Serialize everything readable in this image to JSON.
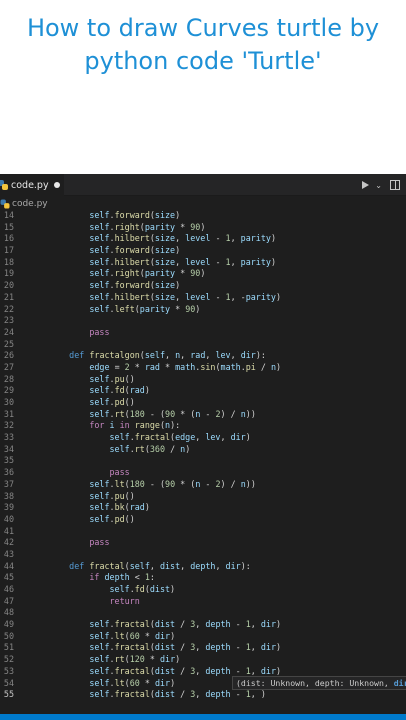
{
  "video_title": "How to draw Curves turtle by python code 'Turtle'",
  "tab": {
    "label": "code.py",
    "icon": "python-file-icon",
    "modified": true
  },
  "breadcrumb": {
    "label": "code.py"
  },
  "toolbar": {
    "run_icon": "run-icon",
    "split_icon": "split-editor-icon"
  },
  "colors": {
    "accent": "#1e90d6",
    "editor_bg": "#1e1e1e",
    "status_bar": "#007acc"
  },
  "code_lines": [
    {
      "number": "14",
      "text": "        self.forward(size)"
    },
    {
      "number": "15",
      "text": "        self.right(parity * 90)"
    },
    {
      "number": "16",
      "text": "        self.hilbert(size, level - 1, parity)"
    },
    {
      "number": "17",
      "text": "        self.forward(size)"
    },
    {
      "number": "18",
      "text": "        self.hilbert(size, level - 1, parity)"
    },
    {
      "number": "19",
      "text": "        self.right(parity * 90)"
    },
    {
      "number": "20",
      "text": "        self.forward(size)"
    },
    {
      "number": "21",
      "text": "        self.hilbert(size, level - 1, -parity)"
    },
    {
      "number": "22",
      "text": "        self.left(parity * 90)"
    },
    {
      "number": "23",
      "text": ""
    },
    {
      "number": "24",
      "text": "        pass"
    },
    {
      "number": "25",
      "text": ""
    },
    {
      "number": "26",
      "text": "    def fractalgon(self, n, rad, lev, dir):"
    },
    {
      "number": "27",
      "text": "        edge = 2 * rad * math.sin(math.pi / n)"
    },
    {
      "number": "28",
      "text": "        self.pu()"
    },
    {
      "number": "29",
      "text": "        self.fd(rad)"
    },
    {
      "number": "30",
      "text": "        self.pd()"
    },
    {
      "number": "31",
      "text": "        self.rt(180 - (90 * (n - 2) / n))"
    },
    {
      "number": "32",
      "text": "        for i in range(n):"
    },
    {
      "number": "33",
      "text": "            self.fractal(edge, lev, dir)"
    },
    {
      "number": "34",
      "text": "            self.rt(360 / n)"
    },
    {
      "number": "35",
      "text": ""
    },
    {
      "number": "36",
      "text": "            pass"
    },
    {
      "number": "37",
      "text": "        self.lt(180 - (90 * (n - 2) / n))"
    },
    {
      "number": "38",
      "text": "        self.pu()"
    },
    {
      "number": "39",
      "text": "        self.bk(rad)"
    },
    {
      "number": "40",
      "text": "        self.pd()"
    },
    {
      "number": "41",
      "text": ""
    },
    {
      "number": "42",
      "text": "        pass"
    },
    {
      "number": "43",
      "text": ""
    },
    {
      "number": "44",
      "text": "    def fractal(self, dist, depth, dir):"
    },
    {
      "number": "45",
      "text": "        if depth < 1:"
    },
    {
      "number": "46",
      "text": "            self.fd(dist)"
    },
    {
      "number": "47",
      "text": "            return"
    },
    {
      "number": "48",
      "text": ""
    },
    {
      "number": "49",
      "text": "        self.fractal(dist / 3, depth - 1, dir)"
    },
    {
      "number": "50",
      "text": "        self.lt(60 * dir)"
    },
    {
      "number": "51",
      "text": "        self.fractal(dist / 3, depth - 1, dir)"
    },
    {
      "number": "52",
      "text": "        self.rt(120 * dir)"
    },
    {
      "number": "53",
      "text": "        self.fractal(dist / 3, depth - 1, dir)"
    },
    {
      "number": "54",
      "text": "        self.lt(60 * dir)"
    },
    {
      "number": "55",
      "text": "        self.fractal(dist / 3, depth - 1, )"
    }
  ],
  "current_line": "55",
  "parameter_hint": {
    "text": "(dist: Unknown, depth: Unknown, ",
    "active_param": "dir:"
  }
}
